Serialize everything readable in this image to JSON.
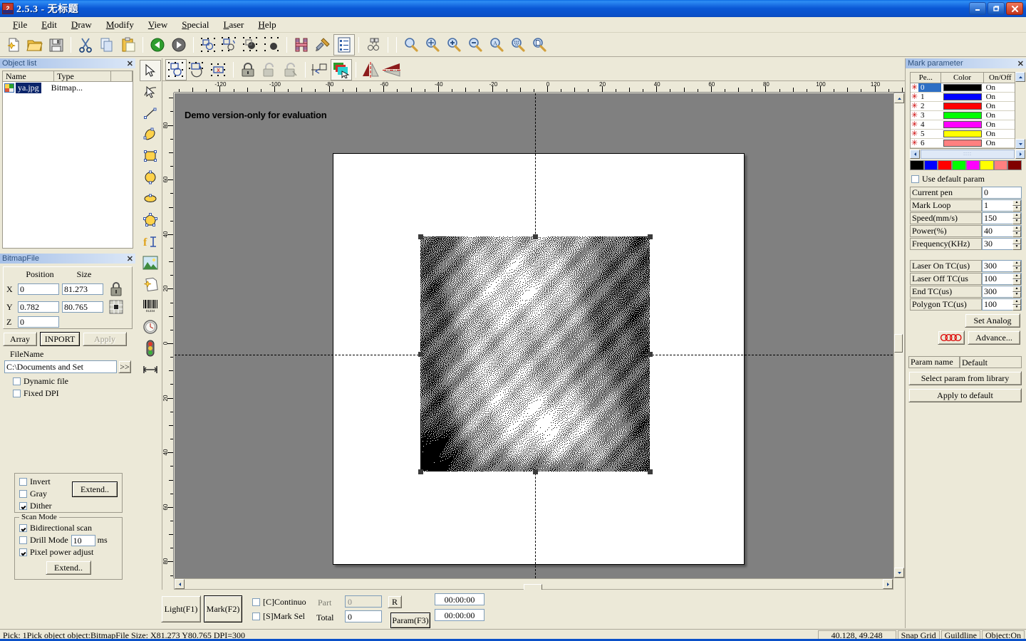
{
  "window": {
    "title": "2.5.3 - 无标题",
    "icon": "app-icon",
    "buttons": {
      "minimize": "_",
      "maximize": "□",
      "close": "✕"
    }
  },
  "menubar": {
    "items": [
      {
        "label": "File",
        "accel": "F"
      },
      {
        "label": "Edit",
        "accel": "E"
      },
      {
        "label": "Draw",
        "accel": "D"
      },
      {
        "label": "Modify",
        "accel": "M"
      },
      {
        "label": "View",
        "accel": "V"
      },
      {
        "label": "Special",
        "accel": "S"
      },
      {
        "label": "Laser",
        "accel": "L"
      },
      {
        "label": "Help",
        "accel": "H"
      }
    ]
  },
  "toolbar": {
    "groups": [
      [
        "new-file-icon",
        "open-file-icon",
        "save-file-icon"
      ],
      [
        "cut-icon",
        "copy-icon",
        "paste-icon"
      ],
      [
        "undo-icon",
        "redo-icon"
      ],
      [
        "group-icon",
        "ungroup-icon",
        "combine-icon",
        "uncombine-icon"
      ],
      [
        "hatch-icon",
        "hatch-settings-icon",
        "object-list-icon"
      ],
      [
        "node-edit-icon"
      ]
    ],
    "zoom_group": [
      "zoom-tool-icon",
      "zoom-pan-icon",
      "zoom-in-icon",
      "zoom-out-icon",
      "zoom-all-icon",
      "zoom-selection-icon",
      "zoom-page-icon"
    ]
  },
  "toolbar2": {
    "items": [
      "select-transform-icon",
      "rotate-icon",
      "delete-node-icon",
      "lock-icon",
      "unlock-icon",
      "unlock-all-icon",
      "align-origin-icon",
      "layer-color-icon",
      "mirror-horizontal-icon",
      "mirror-vertical-icon"
    ]
  },
  "draw_toolbar": {
    "items": [
      "select-arrow-icon",
      "node-edit-arrow-icon",
      "line-icon",
      "curve-icon",
      "rectangle-icon",
      "ellipse-icon",
      "polygon-icon",
      "polyline-icon",
      "text-icon",
      "bitmap-icon",
      "vector-file-icon",
      "barcode-icon",
      "timer-icon",
      "traffic-light-icon",
      "input-port-icon"
    ]
  },
  "object_list": {
    "title": "Object list",
    "close_label": "✕",
    "columns": [
      "Name",
      "Type",
      ""
    ],
    "rows": [
      {
        "icon": "bitmap-thumb-icon",
        "name": "ya.jpg",
        "type": "Bitmap...",
        "selected": true
      }
    ]
  },
  "bitmap_file": {
    "title": "BitmapFile",
    "close_label": "✕",
    "headers": {
      "position": "Position",
      "size": "Size"
    },
    "axes": [
      {
        "label": "X",
        "position": "0",
        "size": "81.273"
      },
      {
        "label": "Y",
        "position": "0.782",
        "size": "80.765"
      },
      {
        "label": "Z",
        "position": "0",
        "size": null
      }
    ],
    "lock_icon": "lock-aspect-icon",
    "anchor_icon": "anchor-grid-icon",
    "buttons": {
      "array": "Array",
      "import": "INPORT",
      "apply": "Apply"
    },
    "filename_label": "FileName",
    "filename_value": "C:\\Documents and Set",
    "browse_label": ">>",
    "dynamic_file": {
      "label": "Dynamic file",
      "checked": false
    },
    "fixed_dpi": {
      "label": "Fixed DPI",
      "checked": false
    }
  },
  "image_options": {
    "invert": {
      "label": "Invert",
      "checked": false
    },
    "gray": {
      "label": "Gray",
      "checked": false
    },
    "dither": {
      "label": "Dither",
      "checked": true
    },
    "extend_button": "Extend..",
    "scan_mode": {
      "legend": "Scan Mode",
      "bidirectional": {
        "label": "Bidirectional scan",
        "checked": true
      },
      "drill_mode": {
        "label": "Drill Mode",
        "checked": false,
        "value": "10",
        "unit": "ms"
      },
      "pixel_power": {
        "label": "Pixel power adjust",
        "checked": true
      },
      "extend_button": "Extend.."
    }
  },
  "canvas": {
    "watermark": "Demo version-only for evaluation",
    "ruler_h_labels": [
      "-120",
      "-100",
      "-80",
      "-60",
      "-40",
      "-20",
      "0",
      "20",
      "40",
      "60",
      "80",
      "100",
      "120"
    ],
    "ruler_v_labels": [
      "80",
      "60",
      "40",
      "20",
      "0",
      "20",
      "40",
      "60",
      "80"
    ],
    "selection": {
      "handles": 8,
      "selected_object": "ya.jpg"
    }
  },
  "bottom_bar": {
    "light_button": "Light(F1)",
    "mark_button": "Mark(F2)",
    "continuous": {
      "label": "[C]Continuo",
      "checked": false
    },
    "mark_sel": {
      "label": "[S]Mark Sel",
      "checked": false
    },
    "part_label": "Part",
    "part_value": "0",
    "total_label": "Total",
    "total_value": "0",
    "r_button": "R",
    "param_button": "Param(F3)",
    "timer1": "00:00:00",
    "timer2": "00:00:00"
  },
  "mark_parameter": {
    "title": "Mark parameter",
    "close_label": "✕",
    "table": {
      "columns": [
        "Pe...",
        "Color",
        "On/Off"
      ],
      "rows": [
        {
          "pen": "0",
          "color": "#000000",
          "state": "On",
          "selected": true
        },
        {
          "pen": "1",
          "color": "#0000ff",
          "state": "On",
          "selected": false
        },
        {
          "pen": "2",
          "color": "#ff0000",
          "state": "On",
          "selected": false
        },
        {
          "pen": "3",
          "color": "#00ff00",
          "state": "On",
          "selected": false
        },
        {
          "pen": "4",
          "color": "#ff00ff",
          "state": "On",
          "selected": false
        },
        {
          "pen": "5",
          "color": "#ffff00",
          "state": "On",
          "selected": false
        },
        {
          "pen": "6",
          "color": "#ff8080",
          "state": "On",
          "selected": false
        }
      ]
    },
    "palette": [
      "#000000",
      "#0000ff",
      "#ff0000",
      "#00ff00",
      "#ff00ff",
      "#ffff00",
      "#ff8080",
      "#800000"
    ],
    "use_default_param": {
      "label": "Use default param",
      "checked": false
    },
    "fields": [
      {
        "label": "Current pen",
        "value": "0",
        "spinner": false,
        "readonly": true
      },
      {
        "label": "Mark Loop",
        "value": "1",
        "spinner": true
      },
      {
        "label": "Speed(mm/s)",
        "value": "150",
        "spinner": true
      },
      {
        "label": "Power(%)",
        "value": "40",
        "spinner": true
      },
      {
        "label": "Frequency(KHz)",
        "value": "30",
        "spinner": true
      }
    ],
    "tc_fields": [
      {
        "label": "Laser On TC(us)",
        "value": "300",
        "spinner": true
      },
      {
        "label": "Laser Off TC(us",
        "value": "100",
        "spinner": true
      },
      {
        "label": "End TC(us)",
        "value": "300",
        "spinner": true
      },
      {
        "label": "Polygon TC(us)",
        "value": "100",
        "spinner": true
      }
    ],
    "set_analog_button": "Set Analog",
    "advance_button": "Advance...",
    "audi_icon": "rings-icon",
    "param_name_label": "Param name",
    "param_name_value": "Default",
    "select_library_button": "Select param from library",
    "apply_default_button": "Apply to default"
  },
  "statusbar": {
    "message": "Pick: 1Pick object object:BitmapFile Size: X81.273 Y80.765 DPI=300",
    "coords": "40.128, 49.248",
    "cells": [
      "Snap Grid",
      "Guildline",
      "Object:On"
    ]
  }
}
